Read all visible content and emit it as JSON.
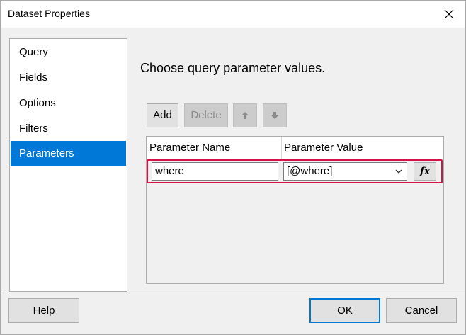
{
  "window": {
    "title": "Dataset Properties",
    "close_icon": "close-icon"
  },
  "sidebar": {
    "items": [
      {
        "label": "Query"
      },
      {
        "label": "Fields"
      },
      {
        "label": "Options"
      },
      {
        "label": "Filters"
      },
      {
        "label": "Parameters",
        "active": true
      }
    ]
  },
  "content": {
    "title": "Choose query parameter values.",
    "toolbar": {
      "add_label": "Add",
      "delete_label": "Delete",
      "move_up_icon": "arrow-up-icon",
      "move_down_icon": "arrow-down-icon"
    },
    "grid": {
      "columns": [
        "Parameter Name",
        "Parameter Value"
      ],
      "rows": [
        {
          "name": "where",
          "value": "[@where]",
          "expression_icon": "fx-icon"
        }
      ]
    }
  },
  "footer": {
    "help_label": "Help",
    "ok_label": "OK",
    "cancel_label": "Cancel"
  },
  "colors": {
    "accent": "#0078d7",
    "highlight_border": "#d31245"
  }
}
